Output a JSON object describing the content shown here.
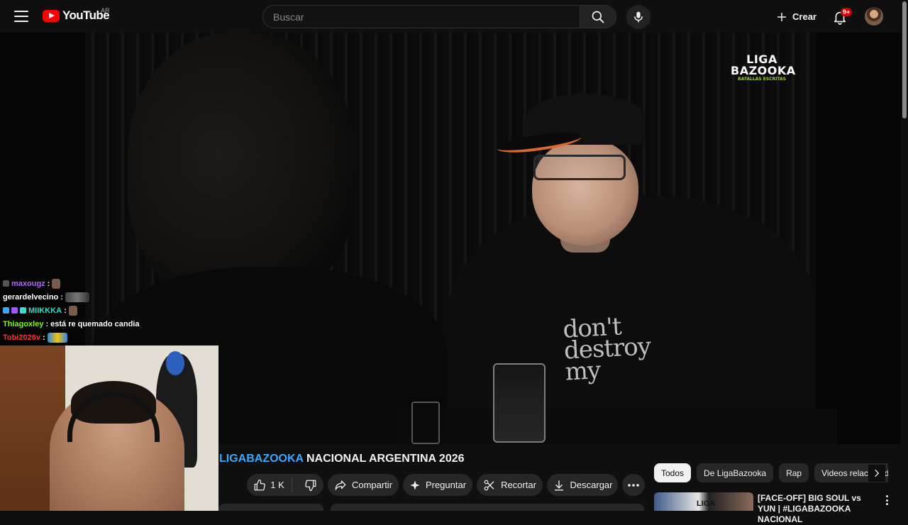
{
  "header": {
    "logo_text": "YouTube",
    "region": "AR",
    "search_placeholder": "Buscar",
    "create_label": "Crear",
    "notification_count": "9+"
  },
  "video": {
    "channel_overlay": {
      "line1": "LIGA",
      "line2": "BAZOOKA",
      "line3": "BATALLAS ESCRITAS"
    },
    "shirt_text": "don't destroy my"
  },
  "chat": {
    "messages": [
      {
        "user": "maxougz",
        "color": "#b368ff",
        "text": ""
      },
      {
        "user": "gerardelvecino",
        "color": "#ffffff",
        "text": ""
      },
      {
        "user": "MIIKKKA",
        "color": "#3fd8c8",
        "text": ""
      },
      {
        "user": "Thiagoxley",
        "color": "#7cfc00",
        "text": "está re quemado candia"
      },
      {
        "user": "Tobi2026v",
        "color": "#ff3030",
        "text": ""
      }
    ]
  },
  "title": {
    "hashtag": "LIGABAZOOKA",
    "rest": " NACIONAL ARGENTINA 2026"
  },
  "actions": {
    "likes": "1 K",
    "share": "Compartir",
    "ask": "Preguntar",
    "clip": "Recortar",
    "download": "Descargar"
  },
  "chips": [
    "Todos",
    "De LigaBazooka",
    "Rap",
    "Videos relacionados"
  ],
  "recommended": [
    {
      "title": "[FACE-OFF] BIG SOUL vs YUN | #LIGABAZOOKA NACIONAL",
      "thumb_text": "LIGA"
    }
  ],
  "colors": {
    "accent": "#ff0000",
    "link": "#3ea6ff",
    "chip_bg": "#272727"
  }
}
